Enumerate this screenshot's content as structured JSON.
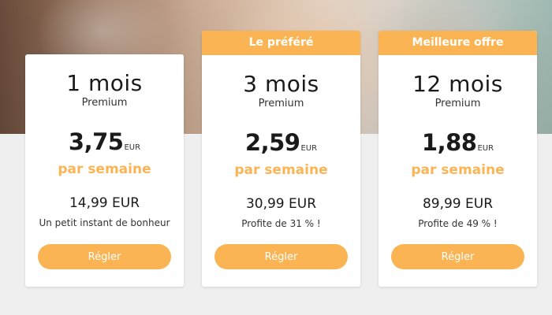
{
  "plans": [
    {
      "badge": "",
      "duration": "1 mois",
      "tier": "Premium",
      "price_weekly": "3,75",
      "currency": "EUR",
      "per_week": "par semaine",
      "total": "14,99 EUR",
      "note": "Un petit instant de bonheur",
      "cta": "Régler"
    },
    {
      "badge": "Le préféré",
      "duration": "3 mois",
      "tier": "Premium",
      "price_weekly": "2,59",
      "currency": "EUR",
      "per_week": "par semaine",
      "total": "30,99 EUR",
      "note": "Profite de 31 % !",
      "cta": "Régler"
    },
    {
      "badge": "Meilleure offre",
      "duration": "12 mois",
      "tier": "Premium",
      "price_weekly": "1,88",
      "currency": "EUR",
      "per_week": "par semaine",
      "total": "89,99 EUR",
      "note": "Profite de 49 % !",
      "cta": "Régler"
    }
  ],
  "colors": {
    "accent": "#fbb454",
    "background": "#efefef",
    "card": "#ffffff"
  }
}
